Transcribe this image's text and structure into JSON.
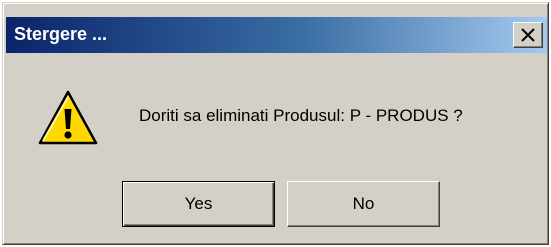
{
  "window": {
    "title": "Stergere ...",
    "close_icon": "close-icon"
  },
  "dialog": {
    "icon": "warning-icon",
    "message": "Doriti sa eliminati Produsul: P - PRODUS ?"
  },
  "buttons": {
    "yes_label": "Yes",
    "no_label": "No"
  },
  "colors": {
    "titlebar_start": "#0a246a",
    "titlebar_end": "#a6caf0",
    "dialog_face": "#d4d0c8",
    "warning_yellow": "#ffd800"
  }
}
